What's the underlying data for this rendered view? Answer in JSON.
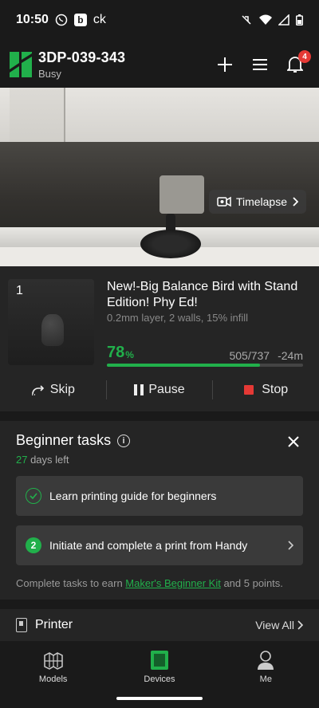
{
  "status_bar": {
    "time": "10:50",
    "badge_letter": "b",
    "app_text": "ck"
  },
  "header": {
    "printer_name": "3DP-039-343",
    "printer_status": "Busy",
    "notification_count": "4"
  },
  "camera": {
    "timelapse_label": "Timelapse"
  },
  "print_job": {
    "plate_number": "1",
    "title": "New!-Big Balance Bird with Stand Edition! Phy Ed!",
    "meta": "0.2mm layer, 2 walls, 15% infill",
    "progress_percent": "78",
    "progress_symbol": "%",
    "progress_fraction": 0.78,
    "layers": "505/737",
    "remaining": "-24m",
    "controls": {
      "skip": "Skip",
      "pause": "Pause",
      "stop": "Stop"
    }
  },
  "beginner_tasks": {
    "title": "Beginner tasks",
    "days_number": "27",
    "days_suffix": " days left",
    "tasks": [
      {
        "label": "Learn printing guide for beginners",
        "done": true
      },
      {
        "label": "Initiate and complete a print from Handy",
        "step": "2",
        "done": false
      }
    ],
    "footer_prefix": "Complete tasks to earn ",
    "footer_link": "Maker's Beginner Kit",
    "footer_suffix": " and 5 points."
  },
  "printer_section": {
    "title": "Printer",
    "view_all": "View All"
  },
  "bottom_nav": {
    "items": [
      {
        "label": "Models",
        "icon": "models-icon"
      },
      {
        "label": "Devices",
        "icon": "devices-icon",
        "active": true
      },
      {
        "label": "Me",
        "icon": "me-icon"
      }
    ]
  },
  "colors": {
    "accent": "#21b04b",
    "stop": "#e53935",
    "background": "#1a1a1a",
    "card": "#252525"
  }
}
